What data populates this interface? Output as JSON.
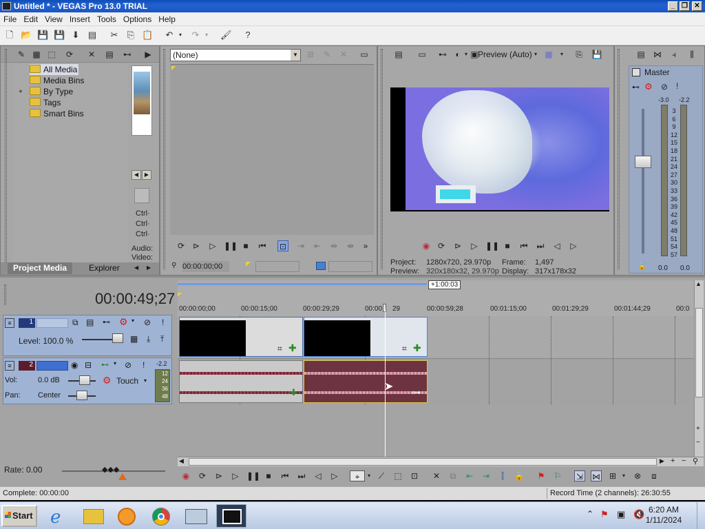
{
  "window": {
    "title": "Untitled * - VEGAS Pro 13.0 TRIAL"
  },
  "menu": [
    "File",
    "Edit",
    "View",
    "Insert",
    "Tools",
    "Options",
    "Help"
  ],
  "media": {
    "tree": [
      "All Media",
      "Media Bins",
      "By Type",
      "Tags",
      "Smart Bins"
    ],
    "tabs": [
      "Project Media",
      "Explorer"
    ],
    "side_labels": [
      "Ctrl·",
      "Ctrl·",
      "Ctrl·",
      "Audio:",
      "Video:"
    ]
  },
  "trimmer": {
    "dropdown": "(None)",
    "timecode": "00:00:00;00"
  },
  "preview": {
    "mode": "Preview (Auto)",
    "project_label": "Project:",
    "project_value": "1280x720, 29.970p",
    "preview_label": "Preview:",
    "preview_value": "320x180x32, 29.970p",
    "frame_label": "Frame:",
    "frame_value": "1,497",
    "display_label": "Display:",
    "display_value": "317x178x32"
  },
  "master": {
    "title": "Master",
    "levels": [
      "-3.0",
      "-2.2"
    ],
    "scale": [
      "3",
      "6",
      "9",
      "12",
      "15",
      "18",
      "21",
      "24",
      "27",
      "30",
      "33",
      "36",
      "39",
      "42",
      "45",
      "48",
      "51",
      "54",
      "57"
    ],
    "bottom_values": [
      "0.0",
      "0.0"
    ]
  },
  "timeline": {
    "timecode": "00:00:49;27",
    "region_label": "+1:00:03",
    "ruler": [
      "00:00:00;00",
      "00:00:15;00",
      "00:00:29;29",
      "00:00:",
      "29",
      "00:00:59;28",
      "00:01:15;00",
      "00:01:29;29",
      "00:01:44;29",
      "00:0"
    ],
    "video_track": {
      "number": "1",
      "level": "Level: 100.0 %"
    },
    "audio_track": {
      "number": "2",
      "vol_label": "Vol:",
      "vol_value": "0.0 dB",
      "pan_label": "Pan:",
      "pan_value": "Center",
      "automation": "Touch",
      "meter_top": "-2.2",
      "meter_scale": [
        "12",
        "24",
        "36",
        "48"
      ]
    },
    "rate": "Rate: 0.00"
  },
  "status": {
    "left": "Complete: 00:00:00",
    "right": "Record Time (2 channels): 26:30:55"
  },
  "taskbar": {
    "start": "Start",
    "time": "6:20 AM",
    "date": "1/11/2024"
  },
  "colors": {
    "panel": "#a7a7a7",
    "track_header": "#9fb3d4",
    "audio_clip": "#6e3340",
    "selection": "#3b6fd4"
  }
}
